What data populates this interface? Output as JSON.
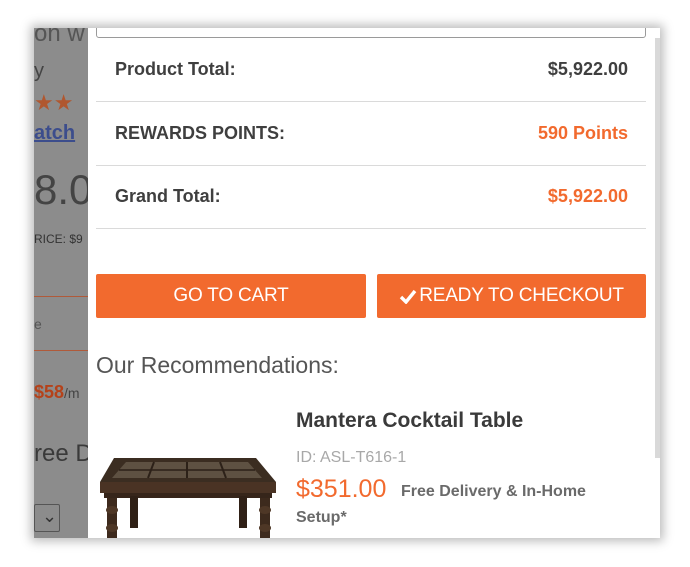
{
  "summary": {
    "product_total_label": "Product Total:",
    "product_total_value": "$5,922.00",
    "rewards_label": "REWARDS POINTS:",
    "rewards_value": "590 Points",
    "grand_total_label": "Grand Total:",
    "grand_total_value": "$5,922.00"
  },
  "buttons": {
    "cart_label": "GO TO CART",
    "checkout_label": "READY TO CHECKOUT",
    "checkout_icon": "check-icon"
  },
  "recommendations": {
    "heading": "Our Recommendations:",
    "item": {
      "name": "Mantera Cocktail Table",
      "id": "ID: ASL-T616-1",
      "price": "$351.00",
      "delivery_line1": "Free Delivery & In-Home",
      "delivery_line2": "Setup*"
    }
  },
  "background_page": {
    "frag_top": "on w",
    "frag_y": "y",
    "stars": "★★",
    "frag_link": "atch",
    "frag_price": "8.0",
    "frag_rice": "RICE: $9",
    "frag_e": "e",
    "frag_monthly_amount": "$58",
    "frag_monthly_unit": "/m",
    "frag_free": "ree D",
    "frag_select": "⌄"
  },
  "colors": {
    "accent": "#f26a2e",
    "overlay": "#8c8c8c",
    "text": "#3f3f3f"
  }
}
